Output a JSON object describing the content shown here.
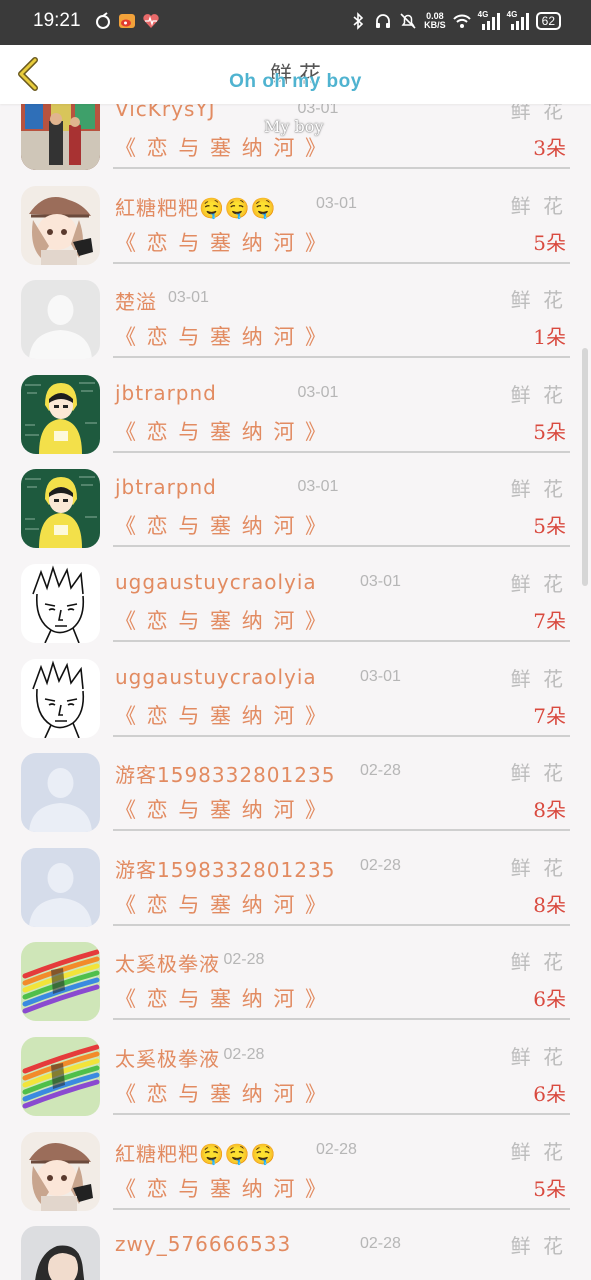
{
  "status_bar": {
    "time": "19:21",
    "speed_value": "0.08",
    "speed_unit": "KB/S",
    "net1": "4G",
    "net2": "4G",
    "battery": "62"
  },
  "header": {
    "title": "鲜 花",
    "decoration": "Oh oh my boy",
    "decoration_sub": "My boy"
  },
  "list": {
    "rows": [
      {
        "name": "VicKrysYJ",
        "date": "03-01",
        "kind": "鲜 花",
        "book": "《 恋 与 塞 纳 河 》",
        "count": "3朵",
        "avatar": "photo-shop"
      },
      {
        "name": "紅糖粑粑🤤🤤🤤",
        "date": "03-01",
        "kind": "鲜 花",
        "book": "《 恋 与 塞 纳 河 》",
        "count": "5朵",
        "avatar": "anime-hat"
      },
      {
        "name": "楚溢",
        "date": "03-01",
        "kind": "鲜 花",
        "book": "《 恋 与 塞 纳 河 》",
        "count": "1朵",
        "avatar": "default-gray"
      },
      {
        "name": "jbtrarpnd",
        "date": "03-01",
        "kind": "鲜 花",
        "book": "《 恋 与 塞 纳 河 》",
        "count": "5朵",
        "avatar": "anime-chalkboard"
      },
      {
        "name": "jbtrarpnd",
        "date": "03-01",
        "kind": "鲜 花",
        "book": "《 恋 与 塞 纳 河 》",
        "count": "5朵",
        "avatar": "anime-chalkboard"
      },
      {
        "name": "uggaustuycraolyia",
        "date": "03-01",
        "kind": "鲜 花",
        "book": "《 恋 与 塞 纳 河 》",
        "count": "7朵",
        "avatar": "manga-sketch"
      },
      {
        "name": "uggaustuycraolyia",
        "date": "03-01",
        "kind": "鲜 花",
        "book": "《 恋 与 塞 纳 河 》",
        "count": "7朵",
        "avatar": "manga-sketch"
      },
      {
        "name": "游客1598332801235",
        "date": "02-28",
        "kind": "鲜 花",
        "book": "《 恋 与 塞 纳 河 》",
        "count": "8朵",
        "avatar": "default-blue"
      },
      {
        "name": "游客1598332801235",
        "date": "02-28",
        "kind": "鲜 花",
        "book": "《 恋 与 塞 纳 河 》",
        "count": "8朵",
        "avatar": "default-blue"
      },
      {
        "name": "太奚极拳液",
        "date": "02-28",
        "kind": "鲜 花",
        "book": "《 恋 与 塞 纳 河 》",
        "count": "6朵",
        "avatar": "rainbow"
      },
      {
        "name": "太奚极拳液",
        "date": "02-28",
        "kind": "鲜 花",
        "book": "《 恋 与 塞 纳 河 》",
        "count": "6朵",
        "avatar": "rainbow"
      },
      {
        "name": "紅糖粑粑🤤🤤🤤",
        "date": "02-28",
        "kind": "鲜 花",
        "book": "《 恋 与 塞 纳 河 》",
        "count": "5朵",
        "avatar": "anime-hat"
      },
      {
        "name": "zwy_576666533",
        "date": "02-28",
        "kind": "鲜 花",
        "book": "",
        "count": "",
        "avatar": "photo-girl"
      }
    ]
  },
  "colors": {
    "name": "#e28b61",
    "count": "#d94a3f",
    "muted": "#bcbcbc",
    "deco": "#4fb3d0"
  }
}
